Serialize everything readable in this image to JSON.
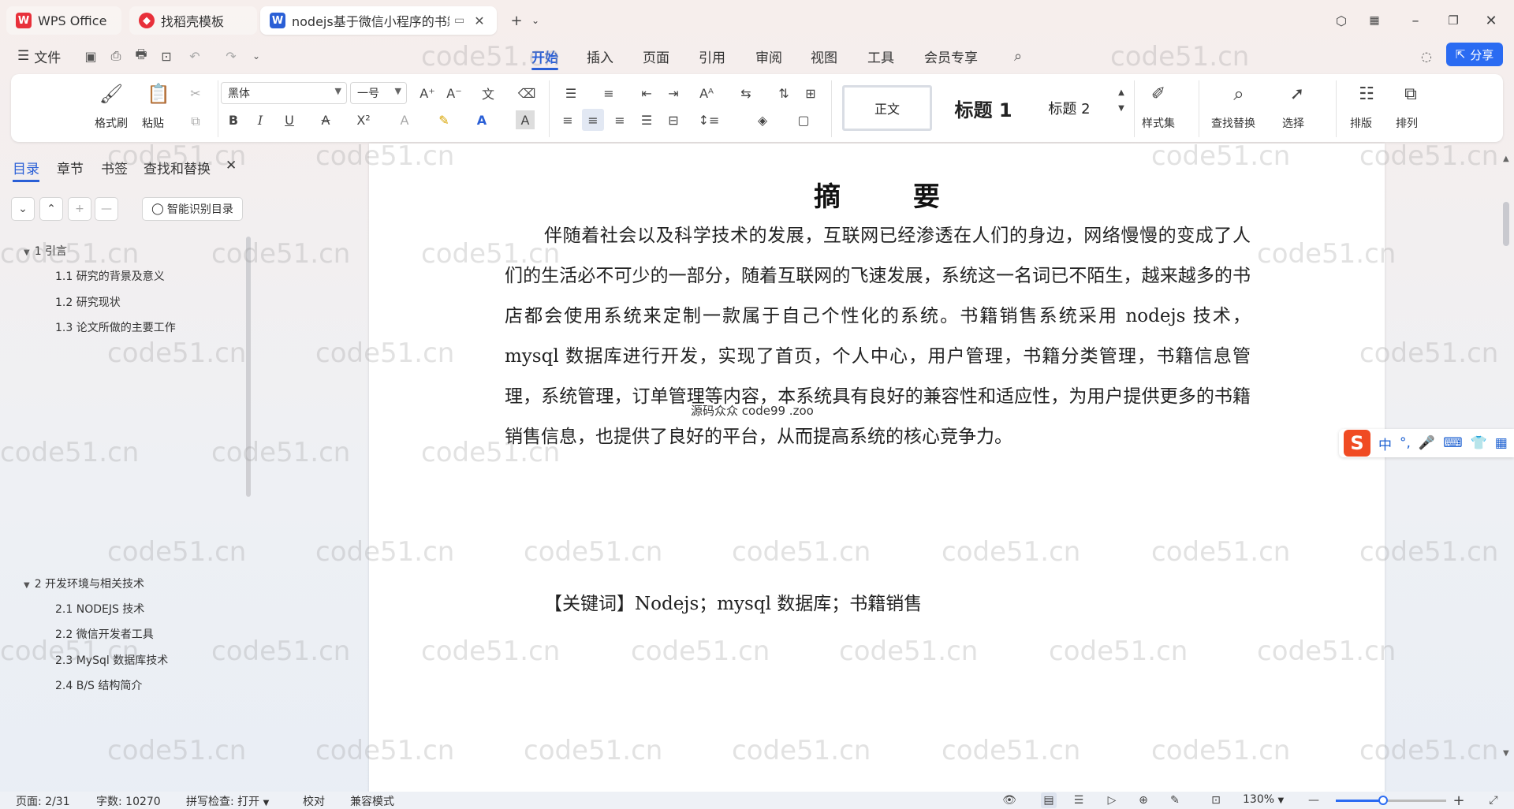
{
  "titlebar": {
    "tabs": [
      {
        "label": "WPS Office"
      },
      {
        "label": "找稻壳模板"
      },
      {
        "label": "nodejs基于微信小程序的书籍"
      }
    ]
  },
  "menubar": {
    "file_label": "文件",
    "items": [
      "开始",
      "插入",
      "页面",
      "引用",
      "审阅",
      "视图",
      "工具",
      "会员专享"
    ],
    "active_item": "开始",
    "share_label": "分享"
  },
  "ribbon": {
    "format_painter": "格式刷",
    "paste": "粘贴",
    "font_name": "黑体",
    "font_size": "一号",
    "style_normal": "正文",
    "style_h1": "标题 1",
    "style_h2": "标题 2",
    "style_set": "样式集",
    "find_replace": "查找替换",
    "select": "选择",
    "layout": "排版",
    "arrange": "排列"
  },
  "leftpane": {
    "tabs": [
      "目录",
      "章节",
      "书签",
      "查找和替换"
    ],
    "active_tab": "目录",
    "ai_toc_label": "智能识别目录",
    "toc": [
      {
        "label": "1  引言",
        "level": 1
      },
      {
        "label": "1.1 研究的背景及意义",
        "level": 2
      },
      {
        "label": "1.2 研究现状",
        "level": 2
      },
      {
        "label": "1.3 论文所做的主要工作",
        "level": 2
      },
      {
        "label": "2  开发环境与相关技术",
        "level": 1
      },
      {
        "label": "2.1 NODEJS 技术",
        "level": 2
      },
      {
        "label": "2.2 微信开发者工具",
        "level": 2
      },
      {
        "label": "2.3 MySql 数据库技术",
        "level": 2
      },
      {
        "label": "2.4 B/S 结构简介",
        "level": 2
      }
    ]
  },
  "document": {
    "title": "摘    要",
    "body": "伴随着社会以及科学技术的发展，互联网已经渗透在人们的身边，网络慢慢的变成了人们的生活必不可少的一部分，随着互联网的飞速发展，系统这一名词已不陌生，越来越多的书店都会使用系统来定制一款属于自己个性化的系统。书籍销售系统采用 nodejs 技术， mysql 数据库进行开发，实现了首页，个人中心，用户管理，书籍分类管理，书籍信息管理，系统管理，订单管理等内容，本系统具有良好的兼容性和适应性，为用户提供更多的书籍销售信息，也提供了良好的平台，从而提高系统的核心竞争力。",
    "keywords": "【关键词】Nodejs；mysql 数据库；书籍销售",
    "overlay_note": "源码众众 code99 .zoo",
    "watermark": "code51.cn"
  },
  "statusbar": {
    "page": "页面: 2/31",
    "wordcount": "字数: 10270",
    "spellcheck": "拼写检查: 打开",
    "proofread": "校对",
    "compat": "兼容模式",
    "zoom": "130%",
    "zoom_fraction": 0.43
  },
  "ime": {
    "lang": "中"
  },
  "colors": {
    "accent": "#2a5fd6",
    "share": "#2a6bf2",
    "ime": "#f04b23"
  }
}
